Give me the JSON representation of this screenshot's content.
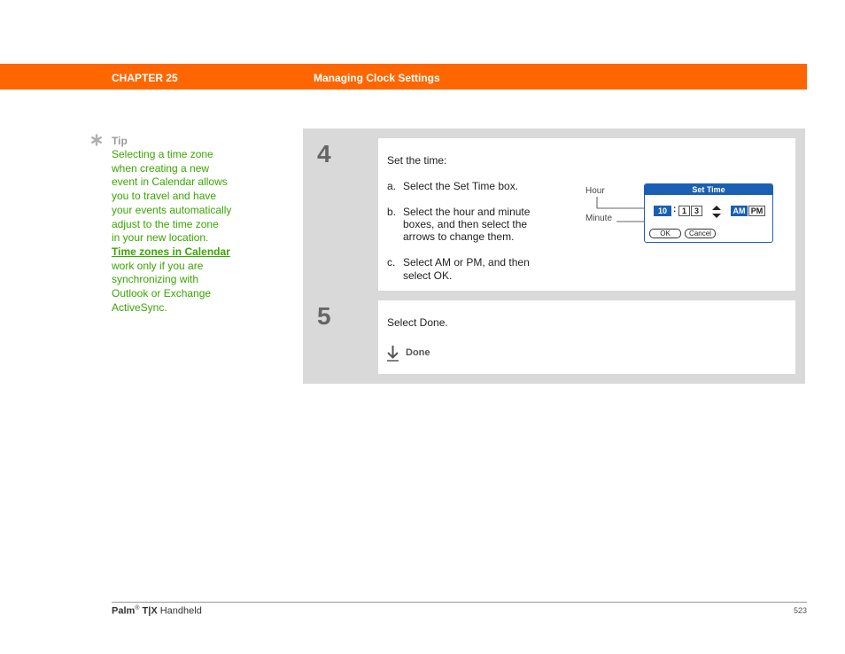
{
  "header": {
    "chapter": "CHAPTER 25",
    "title": "Managing Clock Settings"
  },
  "tip": {
    "icon": "asterisk-icon",
    "heading": "Tip",
    "lines": [
      "Selecting a time zone",
      "when creating a new",
      "event in Calendar allows",
      "you to travel and have",
      "your events automatically",
      "adjust to the time zone",
      "in your new location."
    ],
    "link": "Time zones in Calendar",
    "after_lines": [
      "work only if you are",
      "synchronizing with",
      "Outlook or Exchange",
      "ActiveSync."
    ]
  },
  "steps": [
    {
      "number": "4",
      "intro": "Set the time:",
      "items": [
        {
          "letter": "a.",
          "lines": [
            "Select the Set Time box."
          ]
        },
        {
          "letter": "b.",
          "lines": [
            "Select the hour and minute",
            "boxes, and then select the",
            "arrows to change them."
          ]
        },
        {
          "letter": "c.",
          "lines": [
            "Select AM or PM, and then",
            "select OK."
          ]
        }
      ],
      "figure": {
        "callout_hour": "Hour",
        "callout_minute": "Minute",
        "dialog_title": "Set Time",
        "hour": "10",
        "separator": ":",
        "minute_tens": "1",
        "minute_ones": "3",
        "am": "AM",
        "pm": "PM",
        "ok": "OK",
        "cancel": "Cancel"
      }
    },
    {
      "number": "5",
      "intro": "Select Done.",
      "done_label": "Done",
      "done_icon": "arrow-down-icon"
    }
  ],
  "footer": {
    "brand": "Palm",
    "reg": "®",
    "model": "T|X",
    "product": "Handheld",
    "page": "523"
  },
  "colors": {
    "header": "#ff6600",
    "tip_text": "#3aa600",
    "step_frame": "#d9d9d9",
    "dialog_blue": "#1a5fb4"
  }
}
